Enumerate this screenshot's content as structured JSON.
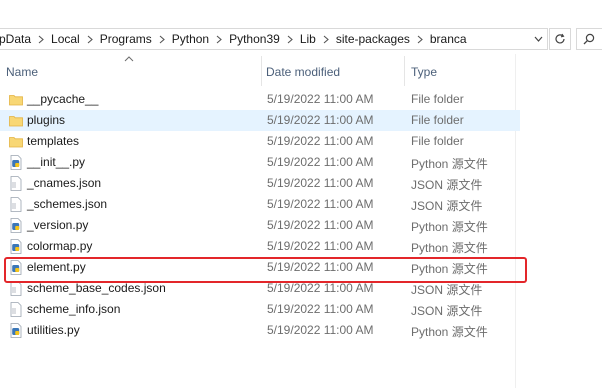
{
  "address": {
    "crumbs": [
      "pData",
      "Local",
      "Programs",
      "Python",
      "Python39",
      "Lib",
      "site-packages",
      "branca"
    ]
  },
  "columns": {
    "name": "Name",
    "date_modified": "Date modified",
    "type": "Type"
  },
  "files": [
    {
      "name": "__pycache__",
      "date": "5/19/2022 11:00 AM",
      "type": "File folder",
      "icon": "folder-icon"
    },
    {
      "name": "plugins",
      "date": "5/19/2022 11:00 AM",
      "type": "File folder",
      "icon": "folder-icon",
      "selected": true
    },
    {
      "name": "templates",
      "date": "5/19/2022 11:00 AM",
      "type": "File folder",
      "icon": "folder-icon"
    },
    {
      "name": "__init__.py",
      "date": "5/19/2022 11:00 AM",
      "type": "Python 源文件",
      "icon": "python-file-icon"
    },
    {
      "name": "_cnames.json",
      "date": "5/19/2022 11:00 AM",
      "type": "JSON 源文件",
      "icon": "json-file-icon"
    },
    {
      "name": "_schemes.json",
      "date": "5/19/2022 11:00 AM",
      "type": "JSON 源文件",
      "icon": "json-file-icon"
    },
    {
      "name": "_version.py",
      "date": "5/19/2022 11:00 AM",
      "type": "Python 源文件",
      "icon": "python-file-icon"
    },
    {
      "name": "colormap.py",
      "date": "5/19/2022 11:00 AM",
      "type": "Python 源文件",
      "icon": "python-file-icon"
    },
    {
      "name": "element.py",
      "date": "5/19/2022 11:00 AM",
      "type": "Python 源文件",
      "icon": "python-file-icon",
      "highlighted": true
    },
    {
      "name": "scheme_base_codes.json",
      "date": "5/19/2022 11:00 AM",
      "type": "JSON 源文件",
      "icon": "json-file-icon"
    },
    {
      "name": "scheme_info.json",
      "date": "5/19/2022 11:00 AM",
      "type": "JSON 源文件",
      "icon": "json-file-icon"
    },
    {
      "name": "utilities.py",
      "date": "5/19/2022 11:00 AM",
      "type": "Python 源文件",
      "icon": "python-file-icon"
    }
  ],
  "colors": {
    "selection": "#e5f3ff",
    "highlight_border": "#e3262a",
    "header_text": "#4c607a",
    "folder": "#f8d775"
  }
}
